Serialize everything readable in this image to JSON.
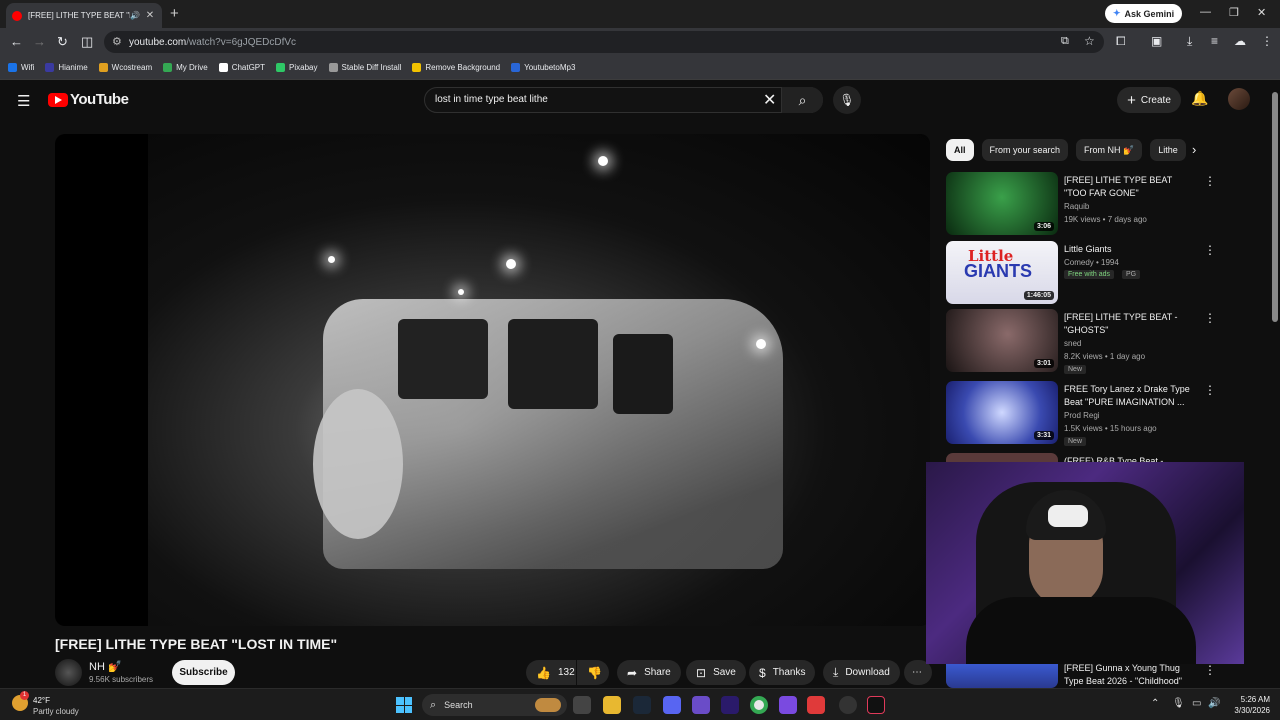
{
  "browser": {
    "tab_title": "[FREE] LITHE TYPE BEAT \"LOST IN TIME\"",
    "new_tab": "+",
    "gemini_label": "Ask Gemini",
    "url_host": "youtube.com",
    "url_path": "/watch?v=6gJQEDcDfVc",
    "bookmarks": [
      "Wifi",
      "Hianime",
      "Wcostream",
      "My Drive",
      "ChatGPT",
      "Pixabay",
      "Stable Diff Install",
      "Remove Background",
      "YoutubetoMp3"
    ],
    "bookmark_colors": [
      "#1a73e8",
      "#3a3aa0",
      "#e0a020",
      "#34a853",
      "#ffffff",
      "#2ec866",
      "#999999",
      "#f2c200",
      "#2966d6"
    ]
  },
  "youtube": {
    "logo_text": "YouTube",
    "search_query": "lost in time type beat lithe",
    "create_label": "Create",
    "video": {
      "title": "[FREE] LITHE TYPE BEAT \"LOST IN TIME\"",
      "channel": "NH 💅",
      "subscribers": "9.56K subscribers",
      "subscribe_label": "Subscribe",
      "likes": "132",
      "share_label": "Share",
      "save_label": "Save",
      "thanks_label": "Thanks",
      "download_label": "Download"
    },
    "chips": [
      "All",
      "From your search",
      "From NH 💅",
      "Lithe"
    ],
    "recommendations": [
      {
        "title": "[FREE] LITHE TYPE BEAT \"TOO FAR GONE\"",
        "channel": "Raquib",
        "meta": "19K views • 7 days ago",
        "duration": "3:06",
        "badge": "",
        "thumb_color": "#1f6b2a"
      },
      {
        "title": "Little Giants",
        "channel": "Comedy • 1994",
        "meta": "",
        "duration": "1:46:05",
        "badge": "Free with ads",
        "badge2": "PG",
        "thumb_color": "#e8e8f0"
      },
      {
        "title": "[FREE] LITHE TYPE BEAT - \"GHOSTS\"",
        "channel": "sned",
        "meta": "8.2K views • 1 day ago",
        "duration": "3:01",
        "badge": "New",
        "thumb_color": "#3a2a2a"
      },
      {
        "title": "FREE Tory Lanez x Drake Type Beat \"PURE IMAGINATION ...",
        "channel": "Prod Regi",
        "meta": "1.5K views • 15 hours ago",
        "duration": "3:31",
        "badge": "New",
        "thumb_color": "#3a4ab0"
      },
      {
        "title": "(FREE) R&B Type Beat -",
        "channel": "",
        "meta": "",
        "duration": "",
        "badge": "",
        "thumb_color": "#5a3a3a"
      }
    ],
    "bottom_rec_title": "[FREE] Gunna x Young Thug Type Beat 2026 - \"Childhood\""
  },
  "taskbar": {
    "temperature": "42°F",
    "weather": "Partly cloudy",
    "notif_count": "1",
    "search_label": "Search",
    "time": "5:26 AM",
    "date": "3/30/2026"
  }
}
